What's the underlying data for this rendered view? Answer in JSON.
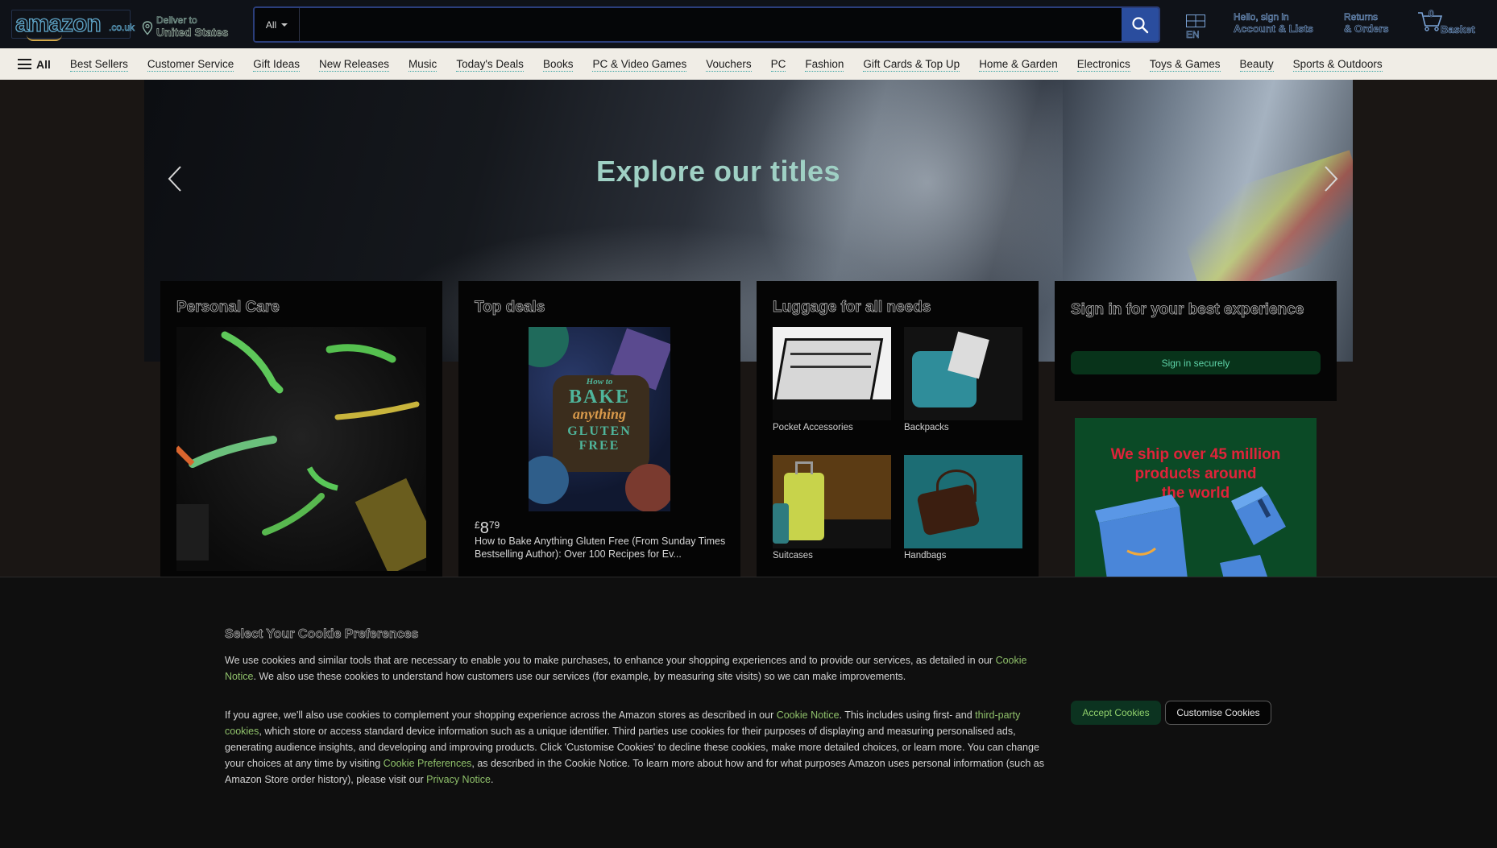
{
  "header": {
    "logo_text": "amazon",
    "logo_tld": ".co.uk",
    "deliver_line1": "Deliver to",
    "deliver_line2": "United States",
    "search": {
      "category": "All",
      "placeholder": "",
      "value": ""
    },
    "flag_line1": "EN",
    "account_line1": "Hello, sign in",
    "account_line2": "Account & Lists",
    "returns_line1": "Returns",
    "returns_line2": "& Orders",
    "basket_count": "0",
    "basket_label": "Basket"
  },
  "nav": {
    "all_label": "All",
    "links": [
      "Best Sellers",
      "Customer Service",
      "Gift Ideas",
      "New Releases",
      "Music",
      "Today's Deals",
      "Books",
      "PC & Video Games",
      "Vouchers",
      "PC",
      "Fashion",
      "Gift Cards & Top Up",
      "Home & Garden",
      "Electronics",
      "Toys & Games",
      "Beauty",
      "Sports & Outdoors"
    ]
  },
  "hero": {
    "title": "Explore our titles"
  },
  "cards": {
    "personal_care": {
      "title": "Personal Care"
    },
    "top_deals": {
      "title": "Top deals",
      "book_line1": "How to",
      "book_line2": "BAKE",
      "book_line3": "anything",
      "book_line4": "GLUTEN",
      "book_line5": "FREE",
      "price_symbol": "£",
      "price_whole": "8",
      "price_fraction": "79",
      "description": "How to Bake Anything Gluten Free (From Sunday Times Bestselling Author): Over 100 Recipes for Ev..."
    },
    "luggage": {
      "title": "Luggage for all needs",
      "tiles": [
        "Pocket Accessories",
        "Backpacks",
        "Suitcases",
        "Handbags"
      ]
    },
    "signin": {
      "title": "Sign in for your best experience",
      "button": "Sign in securely"
    }
  },
  "ship_ad": {
    "line1": "We ship over 45 million",
    "line2": "products around",
    "line3": "the world"
  },
  "cookie": {
    "title": "Select Your Cookie Preferences",
    "p1_a": "We use cookies and similar tools that are necessary to enable you to make purchases, to enhance your shopping experiences and to provide our services, as detailed in our ",
    "p1_link": "Cookie Notice",
    "p1_b": ". We also use these cookies to understand how customers use our services (for example, by measuring site visits) so we can make improvements.",
    "p2_a": "If you agree, we'll also use cookies to complement your shopping experience across the Amazon stores as described in our ",
    "p2_link1": "Cookie Notice",
    "p2_b": ". This includes using first- and ",
    "p2_link2": "third-party cookies",
    "p2_c": ", which store or access standard device information such as a unique identifier. Third parties use cookies for their purposes of displaying and measuring personalised ads, generating audience insights, and developing and improving products. Click 'Customise Cookies' to decline these cookies, make more detailed choices, or learn more. You can change your choices at any time by visiting ",
    "p2_link3": "Cookie Preferences",
    "p2_d": ", as described in the Cookie Notice. To learn more about how and for what purposes Amazon uses personal information (such as Amazon Store order history), please visit our ",
    "p2_link4": "Privacy Notice",
    "p2_e": ".",
    "accept": "Accept Cookies",
    "customise": "Customise Cookies"
  },
  "colors": {
    "nav_bg": "#f0ede6",
    "header_bg": "#0f1218",
    "search_button": "#2a4d9e",
    "link_green": "#8fc06a"
  }
}
